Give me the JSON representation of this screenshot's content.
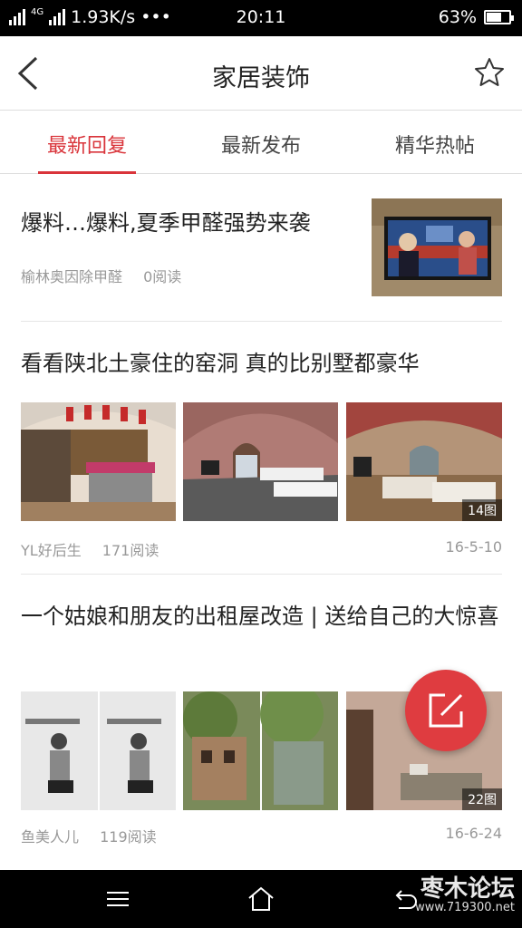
{
  "status": {
    "net_type": "4G",
    "speed": "1.93K/s",
    "more": "•••",
    "time": "20:11",
    "battery": "63%",
    "battery_level": 0.63
  },
  "header": {
    "title": "家居装饰"
  },
  "tabs": [
    {
      "label": "最新回复",
      "active": true
    },
    {
      "label": "最新发布",
      "active": false
    },
    {
      "label": "精华热帖",
      "active": false
    }
  ],
  "posts": [
    {
      "title": "爆料…爆料,夏季甲醛强势来袭",
      "author": "榆林奥因除甲醛",
      "reads": "0阅读"
    },
    {
      "title": "看看陕北土豪住的窑洞 真的比别墅都豪华",
      "author": "YL好后生",
      "reads": "171阅读",
      "date": "16-5-10",
      "image_count": "14图"
    },
    {
      "title": "一个姑娘和朋友的出租屋改造 | 送给自己的大惊喜",
      "author": "鱼美人儿",
      "reads": "119阅读",
      "date": "16-6-24",
      "image_count": "22图"
    }
  ],
  "watermark": {
    "name": "枣木论坛",
    "url": "www.719300.net"
  },
  "colors": {
    "accent": "#d9343a",
    "fab": "#df3c40",
    "meta_text": "#999999"
  },
  "icons": [
    "back-icon",
    "star-icon",
    "compose-icon",
    "menu-icon",
    "home-icon",
    "back-nav-icon"
  ]
}
